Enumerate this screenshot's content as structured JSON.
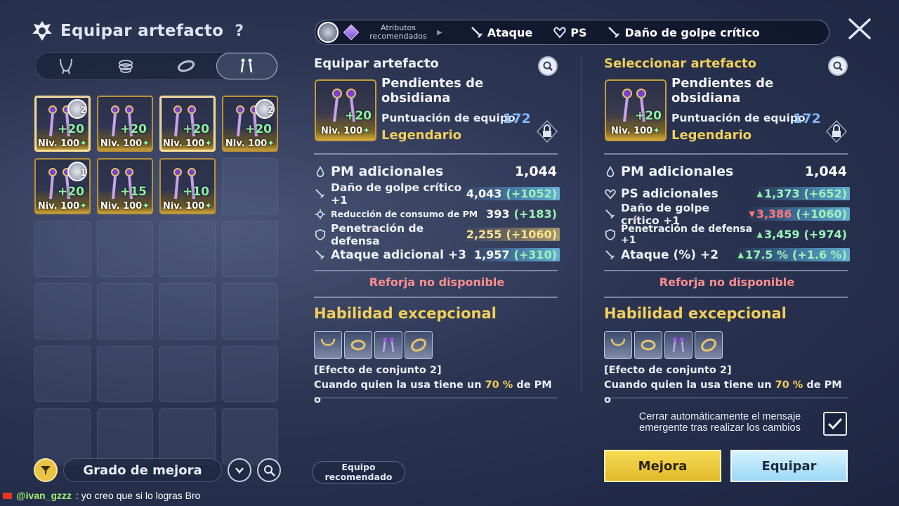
{
  "header": {
    "title": "Equipar artefacto",
    "help": "?"
  },
  "tabs": [
    {
      "icon": "necklace-icon",
      "active": false
    },
    {
      "icon": "bracelet-icon",
      "active": false
    },
    {
      "icon": "ring-icon",
      "active": false
    },
    {
      "icon": "earring-icon",
      "active": true
    }
  ],
  "inventory": [
    {
      "plus": "+20",
      "level": "Niv. 100",
      "badge": "2",
      "selected": true
    },
    {
      "plus": "+20",
      "level": "Niv. 100",
      "badge": "",
      "selected": false
    },
    {
      "plus": "+20",
      "level": "Niv. 100",
      "badge": "",
      "selected": true
    },
    {
      "plus": "+20",
      "level": "Niv. 100",
      "badge": "2",
      "selected": false
    },
    {
      "plus": "+20",
      "level": "Niv. 100",
      "badge": "1",
      "selected": false
    },
    {
      "plus": "+15",
      "level": "Niv. 100",
      "badge": "",
      "selected": false
    },
    {
      "plus": "+10",
      "level": "Niv. 100",
      "badge": "",
      "selected": false
    }
  ],
  "bottom_left": {
    "grade_label": "Grado de mejora"
  },
  "recommended_team": {
    "label": "Equipo recomendado"
  },
  "chat": {
    "user": "@ivan_gzzz",
    "message": ": yo creo que si lo logras Bro"
  },
  "attributes_bar": {
    "label": "Atributos recomendados",
    "items": [
      {
        "label": "Ataque",
        "icon": "sword-icon"
      },
      {
        "label": "PS",
        "icon": "heart-icon"
      },
      {
        "label": "Daño de golpe crítico",
        "icon": "sword-icon"
      }
    ]
  },
  "equipped": {
    "header": "Equipar artefacto",
    "name": "Pendientes de obsidiana",
    "plus": "+20",
    "level": "Niv. 100",
    "score_label": "Puntuación de equipo",
    "score": "172",
    "rarity": "Legendario",
    "main_stat": {
      "label": "PM adicionales",
      "value": "1,044"
    },
    "sub_stats": [
      {
        "label": "Daño de golpe crítico +1",
        "value": "4,043",
        "delta": "(+1052)",
        "size": "mid",
        "style": "hl",
        "icon": "sword-icon"
      },
      {
        "label": "Reducción de consumo de PM",
        "value": "393",
        "delta": "(+183)",
        "size": "small",
        "style": "",
        "icon": "gear-icon"
      },
      {
        "label": "Penetración de defensa",
        "value": "2,255",
        "delta": "(+1060)",
        "size": "mid",
        "style": "hl-y",
        "icon": "shield-icon"
      },
      {
        "label": "Ataque adicional +3",
        "value": "1,957",
        "delta": "(+310)",
        "size": "big",
        "style": "hl",
        "icon": "sword-icon"
      }
    ],
    "reforge": "Reforja no disponible",
    "skill_title": "Habilidad excepcional",
    "set_effect": "[Efecto de conjunto 2]",
    "set_desc_pre": "Cuando quien la usa tiene un ",
    "set_desc_pct": "70 %",
    "set_desc_post": " de PM o"
  },
  "selected": {
    "header": "Seleccionar artefacto",
    "name": "Pendientes de obsidiana",
    "plus": "+20",
    "level": "Niv. 100",
    "score_label": "Puntuación de equipo",
    "score": "172",
    "rarity": "Legendario",
    "main_stat": {
      "label": "PM adicionales",
      "value": "1,044"
    },
    "sub_stats": [
      {
        "label": "PS adicionales",
        "value": "1,373",
        "delta": "(+652)",
        "size": "big",
        "style": "hl",
        "icon": "heart-icon",
        "trend": "up"
      },
      {
        "label": "Daño de golpe crítico +1",
        "value": "3,386",
        "delta": "(+1060)",
        "size": "mid",
        "style": "hl",
        "icon": "sword-icon",
        "trend": "down"
      },
      {
        "label": "Penetración de defensa +1",
        "value": "3,459",
        "delta": "(+974)",
        "size": "small2",
        "style": "",
        "icon": "shield-icon",
        "trend": "up"
      },
      {
        "label": "Ataque (%) +2",
        "value": "17.5 %",
        "delta": "(+1.6 %)",
        "size": "big",
        "style": "hl",
        "icon": "sword-icon",
        "trend": "up"
      }
    ],
    "reforge": "Reforja no disponible",
    "skill_title": "Habilidad excepcional",
    "set_effect": "[Efecto de conjunto 2]",
    "set_desc_pre": "Cuando quien la usa tiene un ",
    "set_desc_pct": "70 %",
    "set_desc_post": " de PM o"
  },
  "auto_close": {
    "text": "Cerrar automáticamente el mensaje emergente tras realizar los cambios",
    "checked": true
  },
  "buttons": {
    "upgrade": "Mejora",
    "equip": "Equipar"
  },
  "colors": {
    "gold": "#f1cf5a",
    "green": "#8ef0a6",
    "red": "#ff7878",
    "score": "#7fb7ff"
  }
}
